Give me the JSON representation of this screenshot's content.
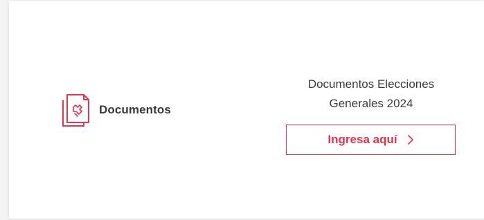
{
  "documents": {
    "label": "Documentos",
    "icon": "document-hand-icon"
  },
  "elections": {
    "headline_line1": "Documentos Elecciones",
    "headline_line2": "Generales 2024",
    "cta_label": "Ingresa aquí",
    "cta_icon": "chevron-right-icon"
  },
  "colors": {
    "accent": "#e4334a",
    "text": "#3a3a3a",
    "card": "#ffffff",
    "background": "#f3f3f3"
  }
}
